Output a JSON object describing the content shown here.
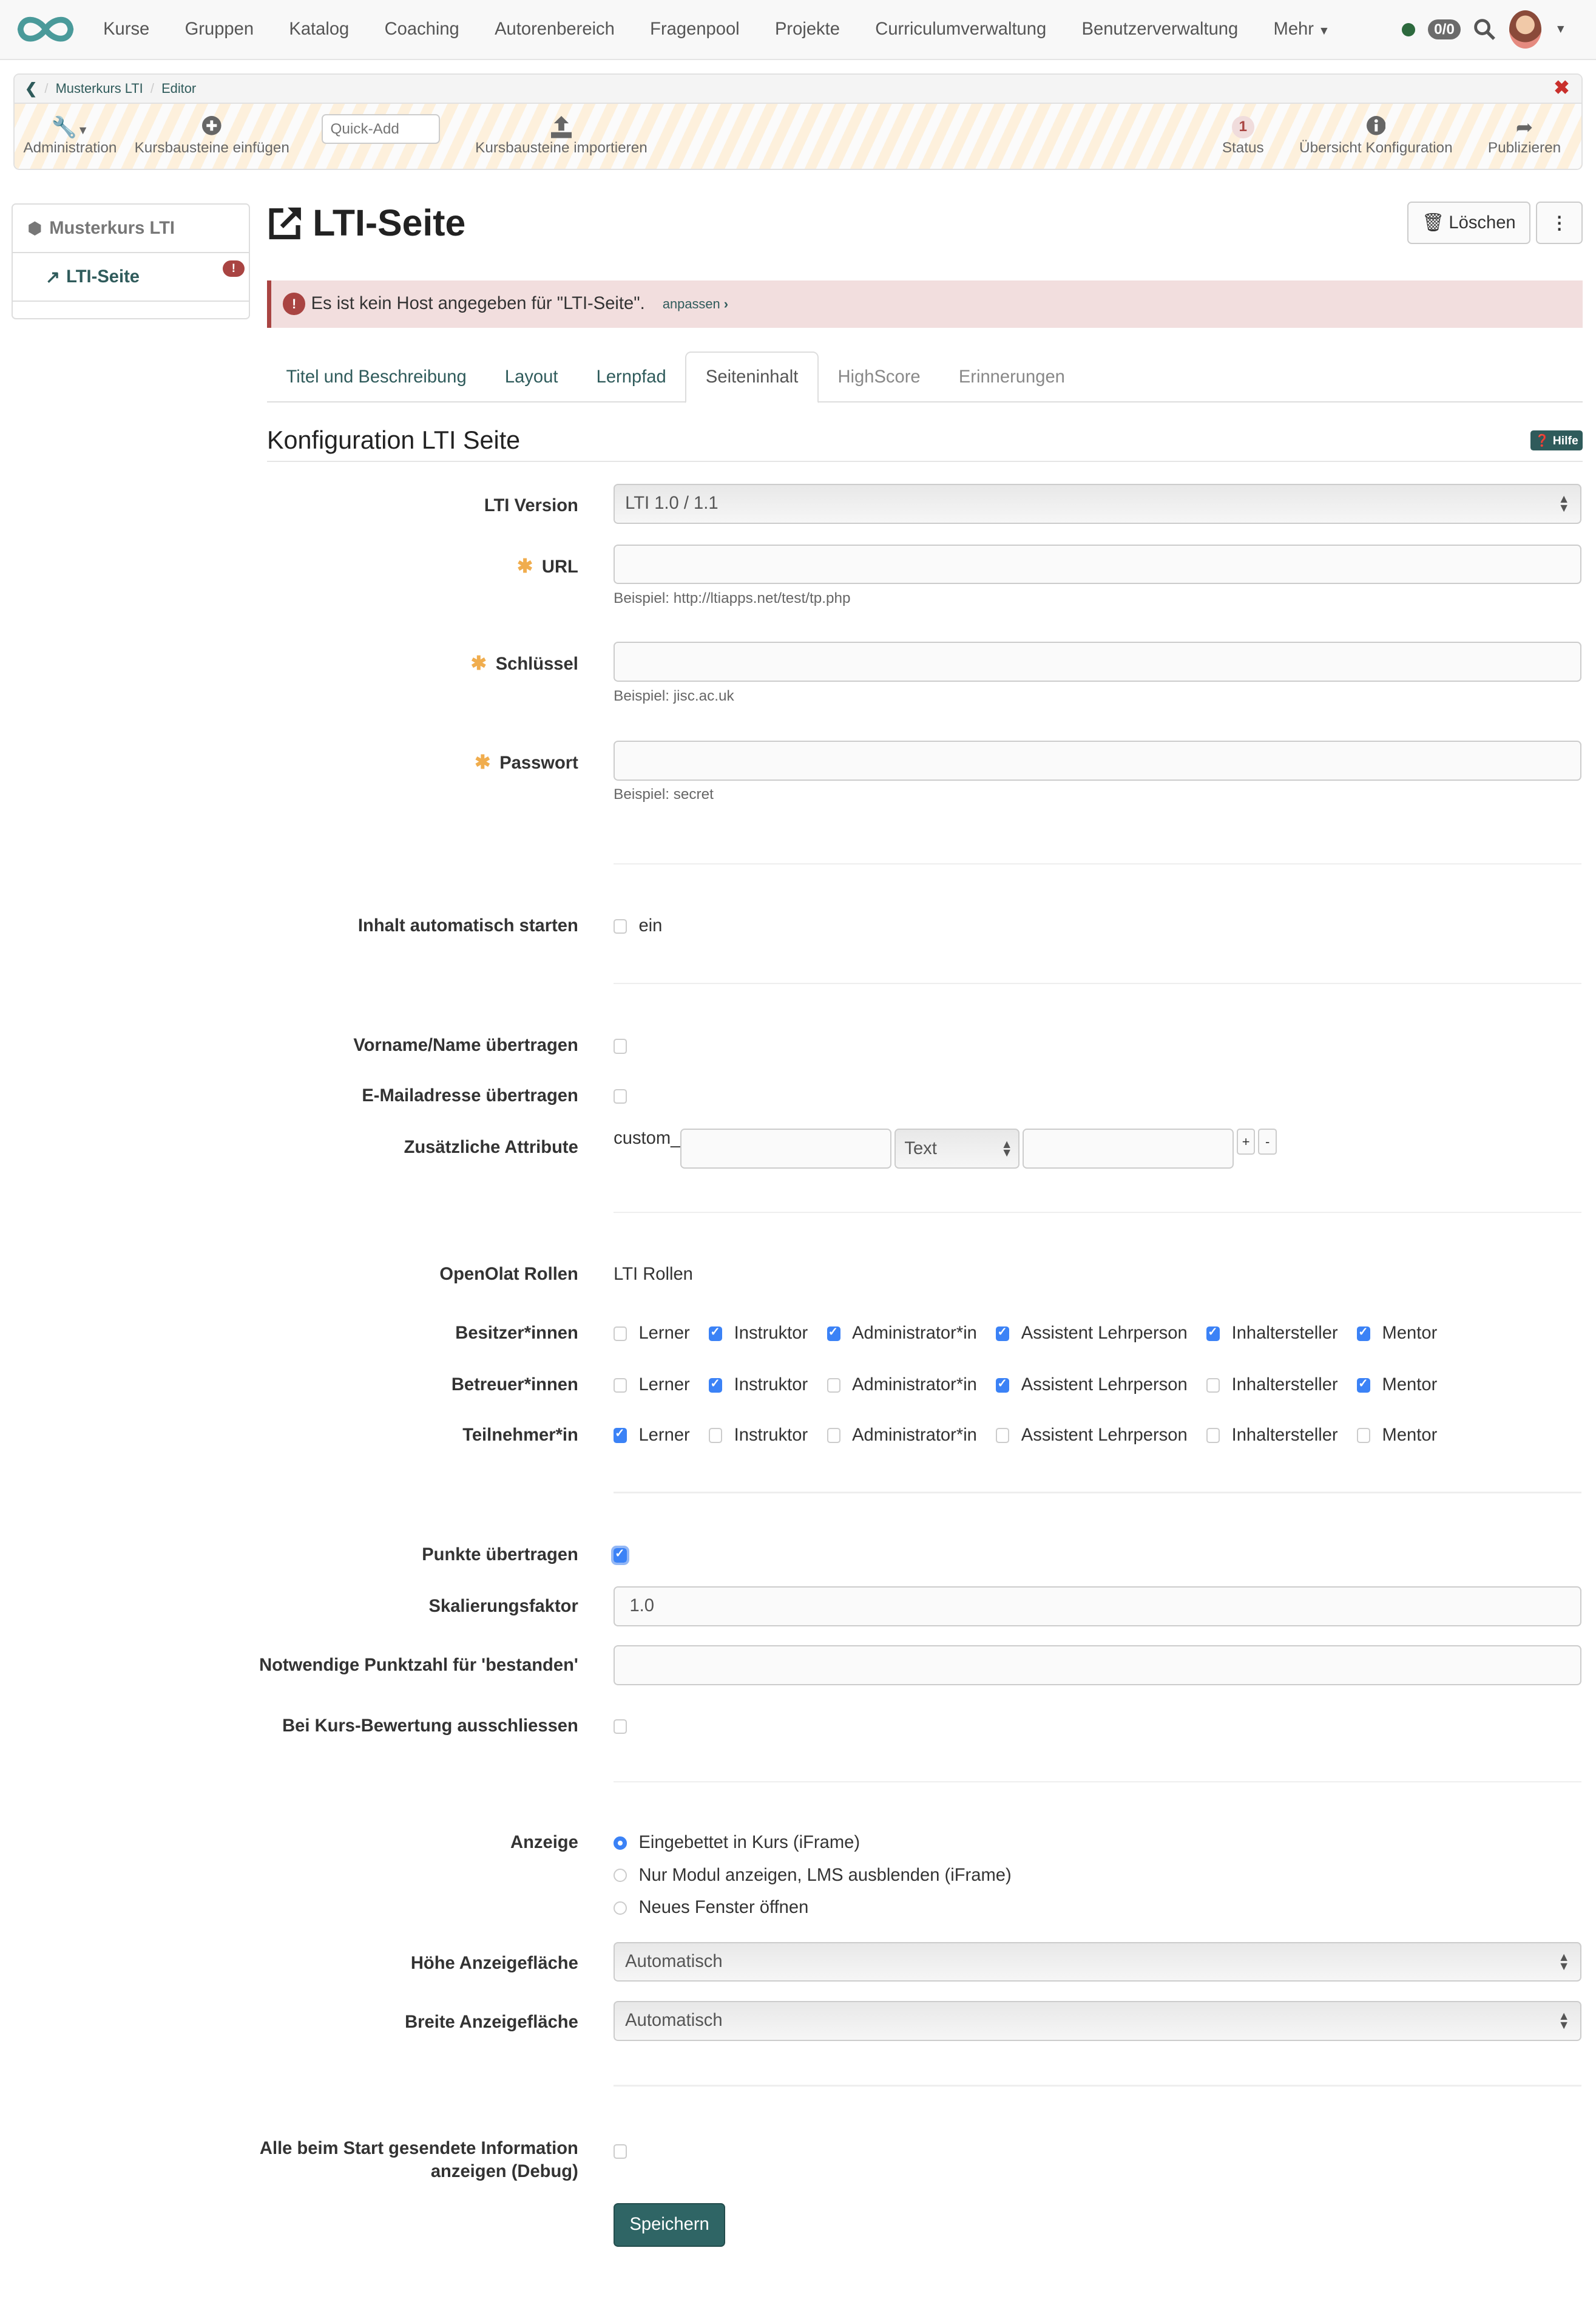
{
  "topnav": {
    "items": [
      "Kurse",
      "Gruppen",
      "Katalog",
      "Coaching",
      "Autorenbereich",
      "Fragenpool",
      "Projekte",
      "Curriculumverwaltung",
      "Benutzerverwaltung",
      "Mehr"
    ],
    "chat_count": "0/0",
    "colors": {
      "brand": "#4a9a9a",
      "online": "#2d6a3e"
    }
  },
  "toolbar": {
    "breadcrumb": [
      "Musterkurs LTI",
      "Editor"
    ],
    "tools_left": [
      "Administration",
      "Kursbausteine einfügen",
      "Kursbausteine importieren"
    ],
    "quick_add_placeholder": "Quick-Add",
    "status_count": "1",
    "tools_right": [
      "Status",
      "Übersicht Konfiguration",
      "Publizieren"
    ]
  },
  "sidebar": {
    "root": "Musterkurs LTI",
    "node": "LTI-Seite",
    "node_warning": "!"
  },
  "main": {
    "title": "LTI-Seite",
    "delete_label": "Löschen",
    "alert": {
      "text": "Es ist kein Host angegeben für \"LTI-Seite\".",
      "link": "anpassen"
    },
    "tabs": [
      "Titel und Beschreibung",
      "Layout",
      "Lernpfad",
      "Seiteninhalt",
      "HighScore",
      "Erinnerungen"
    ],
    "active_tab": "Seiteninhalt",
    "section_title": "Konfiguration LTI Seite",
    "help_label": "Hilfe"
  },
  "form": {
    "lti_version": {
      "label": "LTI Version",
      "value": "LTI 1.0 / 1.1"
    },
    "url": {
      "label": "URL",
      "value": "",
      "hint": "Beispiel: http://ltiapps.net/test/tp.php"
    },
    "key": {
      "label": "Schlüssel",
      "value": "",
      "hint": "Beispiel: jisc.ac.uk"
    },
    "password": {
      "label": "Passwort",
      "value": "",
      "hint": "Beispiel: secret"
    },
    "autostart": {
      "label": "Inhalt automatisch starten",
      "option": "ein",
      "checked": false
    },
    "send_name": {
      "label": "Vorname/Name übertragen",
      "checked": false
    },
    "send_email": {
      "label": "E-Mailadresse übertragen",
      "checked": false
    },
    "attributes": {
      "label": "Zusätzliche Attribute",
      "prefix": "custom_",
      "type": "Text",
      "add": "+",
      "remove": "-"
    },
    "roles": {
      "header_left": "OpenOlat Rollen",
      "header_right": "LTI Rollen",
      "lti_roles": [
        "Lerner",
        "Instruktor",
        "Administrator*in",
        "Assistent Lehrperson",
        "Inhaltersteller",
        "Mentor"
      ],
      "rows": [
        {
          "label": "Besitzer*innen",
          "checked": [
            false,
            true,
            true,
            true,
            true,
            true
          ]
        },
        {
          "label": "Betreuer*innen",
          "checked": [
            false,
            true,
            false,
            true,
            false,
            true
          ]
        },
        {
          "label": "Teilnehmer*in",
          "checked": [
            true,
            false,
            false,
            false,
            false,
            false
          ]
        }
      ]
    },
    "send_score": {
      "label": "Punkte übertragen",
      "checked": true
    },
    "scale": {
      "label": "Skalierungsfaktor",
      "value": "1.0"
    },
    "cut_value": {
      "label": "Notwendige Punktzahl für 'bestanden'",
      "value": ""
    },
    "exclude": {
      "label": "Bei Kurs-Bewertung ausschliessen",
      "checked": false
    },
    "display": {
      "label": "Anzeige",
      "options": [
        "Eingebettet in Kurs (iFrame)",
        "Nur Modul anzeigen, LMS ausblenden (iFrame)",
        "Neues Fenster öffnen"
      ],
      "selected": 0
    },
    "height": {
      "label": "Höhe Anzeigefläche",
      "value": "Automatisch"
    },
    "width": {
      "label": "Breite Anzeigefläche",
      "value": "Automatisch"
    },
    "debug": {
      "label_line1": "Alle beim Start gesendete Information",
      "label_line2": "anzeigen (Debug)",
      "checked": false
    },
    "save_label": "Speichern"
  }
}
